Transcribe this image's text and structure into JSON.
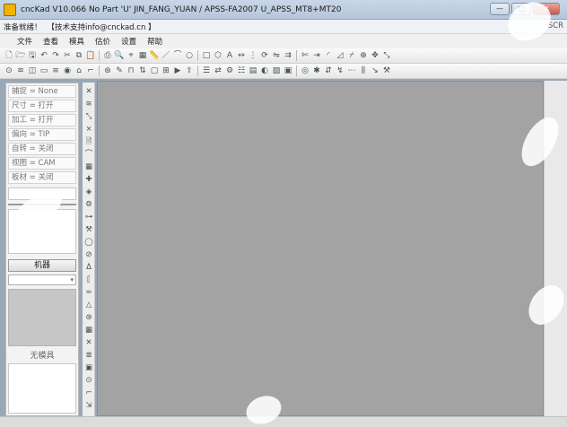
{
  "window": {
    "title": "cncKad V10.066 No Part 'U'  JIN_FANG_YUAN / APSS-FA2007  U_APSS_MT8+MT20",
    "buttons": {
      "minimize": "—",
      "maximize": "□",
      "close": "✕"
    }
  },
  "status": {
    "ready": "准备就绪！",
    "support": "【技术支持info@cnckad.cn 】",
    "right": "SCR"
  },
  "menu": [
    "文件",
    "查看",
    "模具",
    "估价",
    "设置",
    "帮助"
  ],
  "toolbar1": {
    "icons": [
      "new-icon",
      "open-icon",
      "save-icon",
      "undo-icon",
      "redo-icon",
      "cut-icon",
      "copy-icon",
      "paste-icon",
      "print-icon",
      "zoom-icon",
      "snap-icon",
      "grid-icon",
      "measure-icon",
      "line-icon",
      "arc-icon",
      "circle-icon",
      "rect-icon",
      "polygon-icon",
      "text-icon",
      "dimension-icon",
      "array-icon",
      "rotate-icon",
      "mirror-icon",
      "offset-icon",
      "trim-icon",
      "extend-icon",
      "fillet-icon",
      "chamfer-icon",
      "break-icon",
      "join-icon",
      "move-icon",
      "scale-icon"
    ],
    "glyphs": [
      "🗋",
      "🗁",
      "🖫",
      "↶",
      "↷",
      "✂",
      "⧉",
      "📋",
      "⎙",
      "🔍",
      "⌖",
      "▦",
      "📏",
      "／",
      "⌒",
      "○",
      "□",
      "⬡",
      "A",
      "↔",
      "⋮",
      "⟳",
      "⇋",
      "⇉",
      "✄",
      "⇥",
      "◜",
      "◿",
      "⌿",
      "⊕",
      "✥",
      "⤡"
    ]
  },
  "toolbar2": {
    "icons": [
      "punch-icon",
      "nibble-icon",
      "contour-icon",
      "slot-icon",
      "louver-icon",
      "emboss-icon",
      "form-icon",
      "bend-icon",
      "tap-icon",
      "marking-icon",
      "clamp-icon",
      "repos-icon",
      "sheet-icon",
      "nest-icon",
      "simulate-icon",
      "post-icon",
      "report-icon",
      "dnc-icon",
      "macro-icon",
      "options-icon",
      "layers-icon",
      "color-icon",
      "hatch-icon",
      "block-icon",
      "inspect-icon",
      "drill-icon",
      "sort-icon",
      "path-icon",
      "microjoint-icon",
      "common-cut-icon",
      "lead-icon",
      "settings-icon"
    ],
    "glyphs": [
      "⊙",
      "≋",
      "◫",
      "▭",
      "≡",
      "◉",
      "⌂",
      "⌐",
      "⊛",
      "✎",
      "⊓",
      "⇅",
      "▢",
      "⊞",
      "▶",
      "⇪",
      "☰",
      "⇄",
      "⚙",
      "☷",
      "▤",
      "◐",
      "▨",
      "▣",
      "◎",
      "✱",
      "⇵",
      "↯",
      "⋯",
      "⫼",
      "↘",
      "⚒"
    ]
  },
  "left_panel": {
    "settings": [
      "捕捉 = None",
      "尺寸 = 打开",
      "加工 = 打开",
      "偏向 = TIP",
      "自转 = 关闭",
      "视图 = CAM",
      "板材 = 关闭"
    ],
    "machine_button": "机器",
    "no_tool_label": "无模具"
  },
  "vertical_toolbar": {
    "icons": [
      "cross-icon",
      "hatch-icon",
      "line-icon",
      "cross-hatch-icon",
      "doc-icon",
      "arc-icon",
      "fill-icon",
      "plus-icon",
      "shapes-icon",
      "gear-icon",
      "measure-icon",
      "tool-icon",
      "circle-icon",
      "no-icon",
      "a-icon",
      "bracket-icon",
      "wave-icon",
      "triangle-icon",
      "drill-icon",
      "grid-icon",
      "cross2-icon",
      "align-icon",
      "panel-icon",
      "punch-icon",
      "edge-icon",
      "end-icon"
    ],
    "glyphs": [
      "✕",
      "≋",
      "⤡",
      "⨯",
      "🗎",
      "⌒",
      "▦",
      "✚",
      "◈",
      "⚙",
      "⊶",
      "⚒",
      "◯",
      "⊘",
      "ᐃ",
      "⟦",
      "≈",
      "△",
      "⊛",
      "▦",
      "✕",
      "≣",
      "▣",
      "⊙",
      "⌐",
      "⇲"
    ]
  }
}
